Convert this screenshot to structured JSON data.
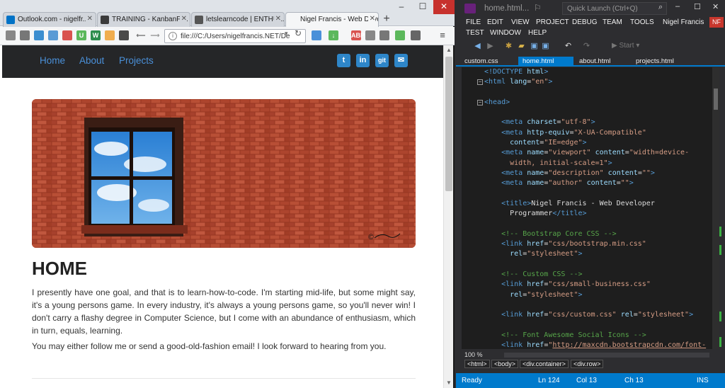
{
  "firefox": {
    "tabs": [
      {
        "label": "Outlook.com - nigelfr...",
        "favicon_color": "#0072c6"
      },
      {
        "label": "TRAINING - KanbanFl...",
        "favicon_color": "#3a3a3a"
      },
      {
        "label": "letslearncode | ENTHU...",
        "favicon_color": "#555555"
      },
      {
        "label": "Nigel Francis - Web Devel...",
        "favicon_color": "",
        "active": true
      }
    ],
    "new_tab": "+",
    "url": "file:///C:/Users/nigelfrancis.NET/De",
    "window_min": "‒",
    "window_max": "☐",
    "window_close": "✕"
  },
  "site": {
    "nav": [
      "Home",
      "About",
      "Projects"
    ],
    "social": [
      "t",
      "in",
      "git",
      "✉"
    ],
    "heading": "HOME",
    "paragraph1": "I presently have one goal, and that is to learn-how-to-code. I'm starting mid-life, but some might say, it's a young persons game. In every industry, it's always a young persons game, so you'll never win! I don't carry a flashy degree in Computer Science, but I come with an abundance of enthusiasm, which in turn, equals, learning.",
    "paragraph2": "You may either follow me or send a good-old-fashion email! I look forward to hearing from you.",
    "hero_signature": "©"
  },
  "vs": {
    "title": "home.html...",
    "quick_launch_placeholder": "Quick Launch (Ctrl+Q)",
    "menu_row1": [
      "FILE",
      "EDIT",
      "VIEW",
      "PROJECT",
      "DEBUG",
      "TEAM",
      "TOOLS"
    ],
    "menu_row2": [
      "TEST",
      "WINDOW",
      "HELP"
    ],
    "user": "Nigel Francis",
    "user_initials": "NF",
    "start_label": "▶ Start ▾",
    "tabs": [
      {
        "label": "custom.css"
      },
      {
        "label": "home.html",
        "active": true
      },
      {
        "label": "about.html"
      },
      {
        "label": "projects.html"
      }
    ],
    "zoom": "100 %",
    "breadcrumbs": [
      "<html>",
      "<body>",
      "<div.container>",
      "<div.row>"
    ],
    "status": {
      "ready": "Ready",
      "ln": "Ln 124",
      "col": "Col 13",
      "ch": "Ch 13",
      "ins": "INS"
    }
  }
}
